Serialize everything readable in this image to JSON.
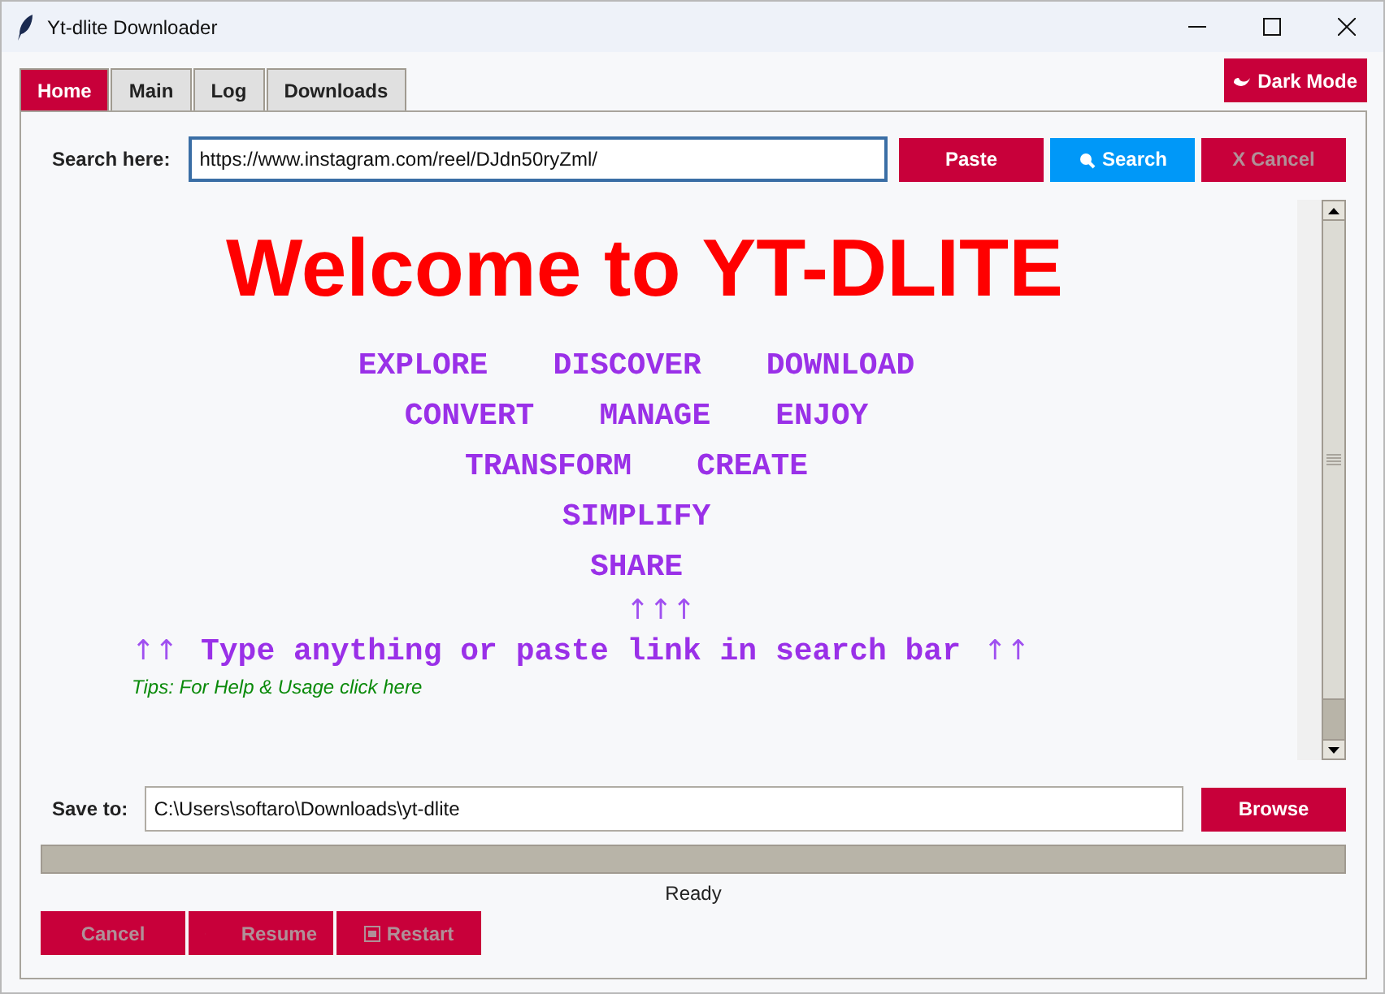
{
  "window": {
    "title": "Yt-dlite Downloader"
  },
  "tabs": [
    {
      "label": "Home",
      "selected": true
    },
    {
      "label": "Main",
      "selected": false
    },
    {
      "label": "Log",
      "selected": false
    },
    {
      "label": "Downloads",
      "selected": false
    }
  ],
  "dark_mode_button": {
    "label": "Dark Mode"
  },
  "search": {
    "label": "Search here:",
    "value": "https://www.instagram.com/reel/DJdn50ryZml/"
  },
  "search_buttons": [
    {
      "kind": "paste",
      "label": "Paste",
      "disabled": false
    },
    {
      "kind": "search",
      "label": "Search",
      "disabled": false
    },
    {
      "kind": "cancel",
      "label": "X Cancel",
      "disabled": true
    }
  ],
  "welcome": {
    "title": "Welcome to YT-DLITE",
    "word_rows": [
      [
        "EXPLORE",
        "DISCOVER",
        "DOWNLOAD"
      ],
      [
        "CONVERT",
        "MANAGE",
        "ENJOY"
      ],
      [
        "TRANSFORM",
        "CREATE"
      ],
      [
        "SIMPLIFY"
      ],
      [
        "SHARE"
      ]
    ],
    "arrows": "↑↑↑",
    "left_arrows": "↑↑",
    "instruction": "Type anything or paste link in search bar",
    "right_arrows": "↑↑",
    "tips": "Tips: For Help & Usage click here"
  },
  "save": {
    "label": "Save to:",
    "value": "C:\\Users\\softaro\\Downloads\\yt-dlite",
    "button": "Browse"
  },
  "progress": {
    "level": 0
  },
  "status": "Ready",
  "bottom_buttons": [
    {
      "kind": "cancel",
      "label": "Cancel",
      "disabled": true
    },
    {
      "kind": "resume",
      "label": "Resume",
      "disabled": true
    },
    {
      "kind": "restart",
      "label": "Restart",
      "disabled": true
    }
  ]
}
